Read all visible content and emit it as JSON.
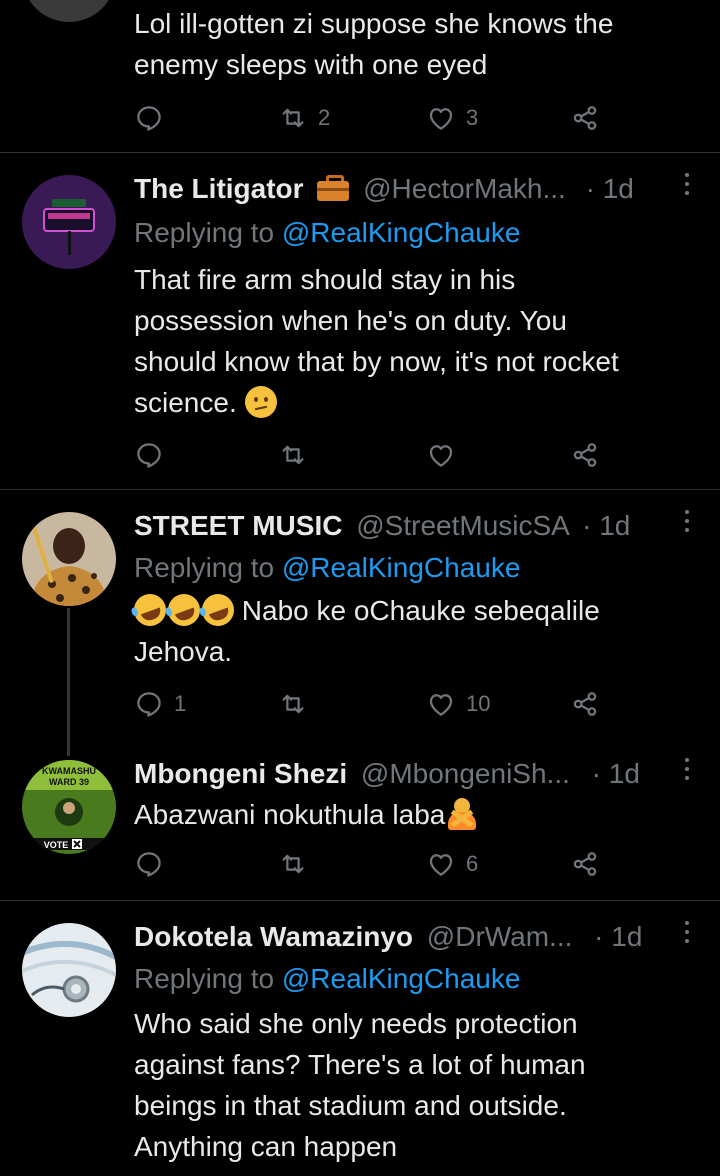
{
  "tweets": [
    {
      "body": [
        "Lol ill-gotten zi suppose she knows the",
        "enemy  sleeps with one eyed"
      ],
      "actions": {
        "reply": "",
        "retweet": "2",
        "like": "3"
      }
    },
    {
      "name": "The Litigator",
      "name_badge": "briefcase",
      "handle": "@HectorMakh...",
      "dot": "·",
      "time": "1d",
      "reply_prefix": "Replying to ",
      "reply_to": "@RealKingChauke",
      "body": [
        "That fire arm should stay in his",
        "possession when he's on duty. You",
        "should know that by now, it's not rocket",
        "science. "
      ],
      "body_emoji": "confused-face",
      "actions": {
        "reply": "",
        "retweet": "",
        "like": ""
      }
    },
    {
      "name": "STREET MUSIC",
      "handle": "@StreetMusicSA",
      "dot": "·",
      "time": "1d",
      "reply_prefix": "Replying to ",
      "reply_to": "@RealKingChauke",
      "body": [
        " Nabo ke oChauke sebeqalile",
        "Jehova."
      ],
      "body_emoji": "rolling-on-floor-laughing x3",
      "actions": {
        "reply": "1",
        "retweet": "",
        "like": "10"
      }
    },
    {
      "name": "Mbongeni Shezi",
      "handle": "@MbongeniSh...",
      "dot": "·",
      "time": "1d",
      "body": [
        "Abazwani nokuthula laba"
      ],
      "body_emoji": "person-gesturing-no",
      "avatar_text": {
        "top": "KWAMASHU",
        "mid": "WARD 39",
        "bottom": "VOTE"
      },
      "actions": {
        "reply": "",
        "retweet": "",
        "like": "6"
      }
    },
    {
      "name": "Dokotela Wamazinyo",
      "handle": "@DrWam...",
      "dot": "·",
      "time": "1d",
      "reply_prefix": "Replying to ",
      "reply_to": "@RealKingChauke",
      "body": [
        "Who said she only needs protection",
        "against fans? There's a lot of human",
        "beings in that stadium and outside.",
        "Anything can happen"
      ],
      "actions": {
        "reply": "",
        "retweet": "",
        "like": ""
      }
    }
  ],
  "colors": {
    "bg": "#000000",
    "text": "#e7e9ea",
    "muted": "#71767b",
    "link": "#1d9bf0",
    "divider": "#2f3336"
  }
}
